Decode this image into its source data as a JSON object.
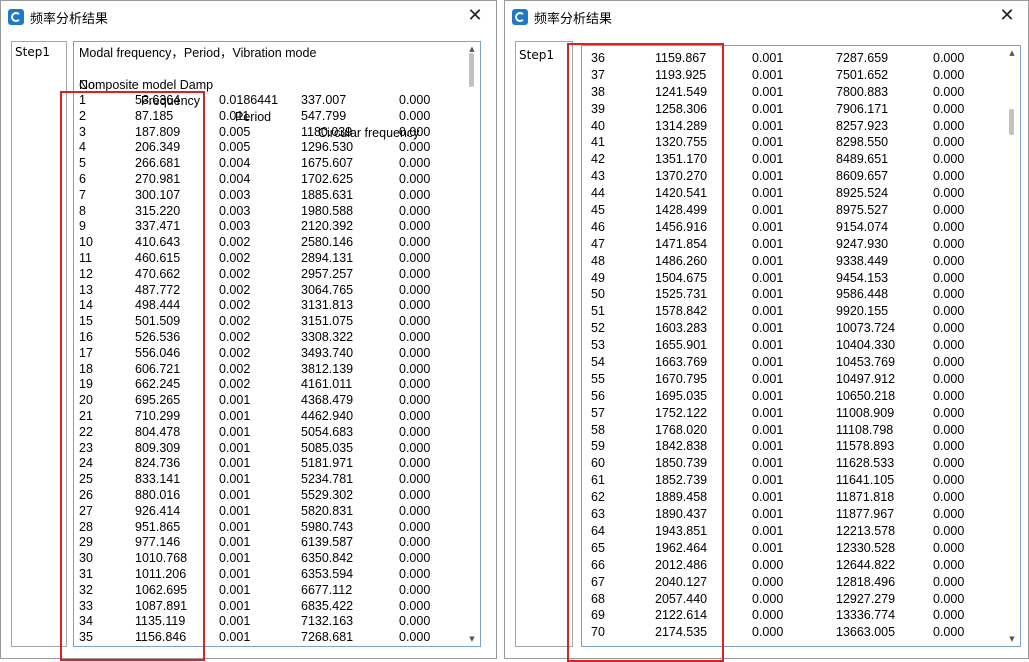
{
  "window_title": "频率分析结果",
  "step_label": "Step1",
  "close_glyph": "✕",
  "header": {
    "line1": "Modal frequency，Period，Vibration mode",
    "line2_no": "No.",
    "line2_freq": "Frequency",
    "line2_period": "Period",
    "line2_circ": "Circular frequency",
    "line3": "Composite model Damp"
  },
  "left_rows": [
    [
      "1",
      "53.6364",
      "0.0186441",
      "337.007",
      "0.000"
    ],
    [
      "2",
      "87.185",
      "0.011",
      "547.799",
      "0.000"
    ],
    [
      "3",
      "187.809",
      "0.005",
      "1180.039",
      "0.000"
    ],
    [
      "4",
      "206.349",
      "0.005",
      "1296.530",
      "0.000"
    ],
    [
      "5",
      "266.681",
      "0.004",
      "1675.607",
      "0.000"
    ],
    [
      "6",
      "270.981",
      "0.004",
      "1702.625",
      "0.000"
    ],
    [
      "7",
      "300.107",
      "0.003",
      "1885.631",
      "0.000"
    ],
    [
      "8",
      "315.220",
      "0.003",
      "1980.588",
      "0.000"
    ],
    [
      "9",
      "337.471",
      "0.003",
      "2120.392",
      "0.000"
    ],
    [
      "10",
      "410.643",
      "0.002",
      "2580.146",
      "0.000"
    ],
    [
      "11",
      "460.615",
      "0.002",
      "2894.131",
      "0.000"
    ],
    [
      "12",
      "470.662",
      "0.002",
      "2957.257",
      "0.000"
    ],
    [
      "13",
      "487.772",
      "0.002",
      "3064.765",
      "0.000"
    ],
    [
      "14",
      "498.444",
      "0.002",
      "3131.813",
      "0.000"
    ],
    [
      "15",
      "501.509",
      "0.002",
      "3151.075",
      "0.000"
    ],
    [
      "16",
      "526.536",
      "0.002",
      "3308.322",
      "0.000"
    ],
    [
      "17",
      "556.046",
      "0.002",
      "3493.740",
      "0.000"
    ],
    [
      "18",
      "606.721",
      "0.002",
      "3812.139",
      "0.000"
    ],
    [
      "19",
      "662.245",
      "0.002",
      "4161.011",
      "0.000"
    ],
    [
      "20",
      "695.265",
      "0.001",
      "4368.479",
      "0.000"
    ],
    [
      "21",
      "710.299",
      "0.001",
      "4462.940",
      "0.000"
    ],
    [
      "22",
      "804.478",
      "0.001",
      "5054.683",
      "0.000"
    ],
    [
      "23",
      "809.309",
      "0.001",
      "5085.035",
      "0.000"
    ],
    [
      "24",
      "824.736",
      "0.001",
      "5181.971",
      "0.000"
    ],
    [
      "25",
      "833.141",
      "0.001",
      "5234.781",
      "0.000"
    ],
    [
      "26",
      "880.016",
      "0.001",
      "5529.302",
      "0.000"
    ],
    [
      "27",
      "926.414",
      "0.001",
      "5820.831",
      "0.000"
    ],
    [
      "28",
      "951.865",
      "0.001",
      "5980.743",
      "0.000"
    ],
    [
      "29",
      "977.146",
      "0.001",
      "6139.587",
      "0.000"
    ],
    [
      "30",
      "1010.768",
      "0.001",
      "6350.842",
      "0.000"
    ],
    [
      "31",
      "1011.206",
      "0.001",
      "6353.594",
      "0.000"
    ],
    [
      "32",
      "1062.695",
      "0.001",
      "6677.112",
      "0.000"
    ],
    [
      "33",
      "1087.891",
      "0.001",
      "6835.422",
      "0.000"
    ],
    [
      "34",
      "1135.119",
      "0.001",
      "7132.163",
      "0.000"
    ],
    [
      "35",
      "1156.846",
      "0.001",
      "7268.681",
      "0.000"
    ]
  ],
  "right_rows": [
    [
      "36",
      "1159.867",
      "0.001",
      "7287.659",
      "0.000"
    ],
    [
      "37",
      "1193.925",
      "0.001",
      "7501.652",
      "0.000"
    ],
    [
      "38",
      "1241.549",
      "0.001",
      "7800.883",
      "0.000"
    ],
    [
      "39",
      "1258.306",
      "0.001",
      "7906.171",
      "0.000"
    ],
    [
      "40",
      "1314.289",
      "0.001",
      "8257.923",
      "0.000"
    ],
    [
      "41",
      "1320.755",
      "0.001",
      "8298.550",
      "0.000"
    ],
    [
      "42",
      "1351.170",
      "0.001",
      "8489.651",
      "0.000"
    ],
    [
      "43",
      "1370.270",
      "0.001",
      "8609.657",
      "0.000"
    ],
    [
      "44",
      "1420.541",
      "0.001",
      "8925.524",
      "0.000"
    ],
    [
      "45",
      "1428.499",
      "0.001",
      "8975.527",
      "0.000"
    ],
    [
      "46",
      "1456.916",
      "0.001",
      "9154.074",
      "0.000"
    ],
    [
      "47",
      "1471.854",
      "0.001",
      "9247.930",
      "0.000"
    ],
    [
      "48",
      "1486.260",
      "0.001",
      "9338.449",
      "0.000"
    ],
    [
      "49",
      "1504.675",
      "0.001",
      "9454.153",
      "0.000"
    ],
    [
      "50",
      "1525.731",
      "0.001",
      "9586.448",
      "0.000"
    ],
    [
      "51",
      "1578.842",
      "0.001",
      "9920.155",
      "0.000"
    ],
    [
      "52",
      "1603.283",
      "0.001",
      "10073.724",
      "0.000"
    ],
    [
      "53",
      "1655.901",
      "0.001",
      "10404.330",
      "0.000"
    ],
    [
      "54",
      "1663.769",
      "0.001",
      "10453.769",
      "0.000"
    ],
    [
      "55",
      "1670.795",
      "0.001",
      "10497.912",
      "0.000"
    ],
    [
      "56",
      "1695.035",
      "0.001",
      "10650.218",
      "0.000"
    ],
    [
      "57",
      "1752.122",
      "0.001",
      "11008.909",
      "0.000"
    ],
    [
      "58",
      "1768.020",
      "0.001",
      "11108.798",
      "0.000"
    ],
    [
      "59",
      "1842.838",
      "0.001",
      "11578.893",
      "0.000"
    ],
    [
      "60",
      "1850.739",
      "0.001",
      "11628.533",
      "0.000"
    ],
    [
      "61",
      "1852.739",
      "0.001",
      "11641.105",
      "0.000"
    ],
    [
      "62",
      "1889.458",
      "0.001",
      "11871.818",
      "0.000"
    ],
    [
      "63",
      "1890.437",
      "0.001",
      "11877.967",
      "0.000"
    ],
    [
      "64",
      "1943.851",
      "0.001",
      "12213.578",
      "0.000"
    ],
    [
      "65",
      "1962.464",
      "0.001",
      "12330.528",
      "0.000"
    ],
    [
      "66",
      "2012.486",
      "0.000",
      "12644.822",
      "0.000"
    ],
    [
      "67",
      "2040.127",
      "0.000",
      "12818.496",
      "0.000"
    ],
    [
      "68",
      "2057.440",
      "0.000",
      "12927.279",
      "0.000"
    ],
    [
      "69",
      "2122.614",
      "0.000",
      "13336.774",
      "0.000"
    ],
    [
      "70",
      "2174.535",
      "0.000",
      "13663.005",
      "0.000"
    ]
  ],
  "highlight_color": "#e02020",
  "accent_color": "#1f79c9"
}
